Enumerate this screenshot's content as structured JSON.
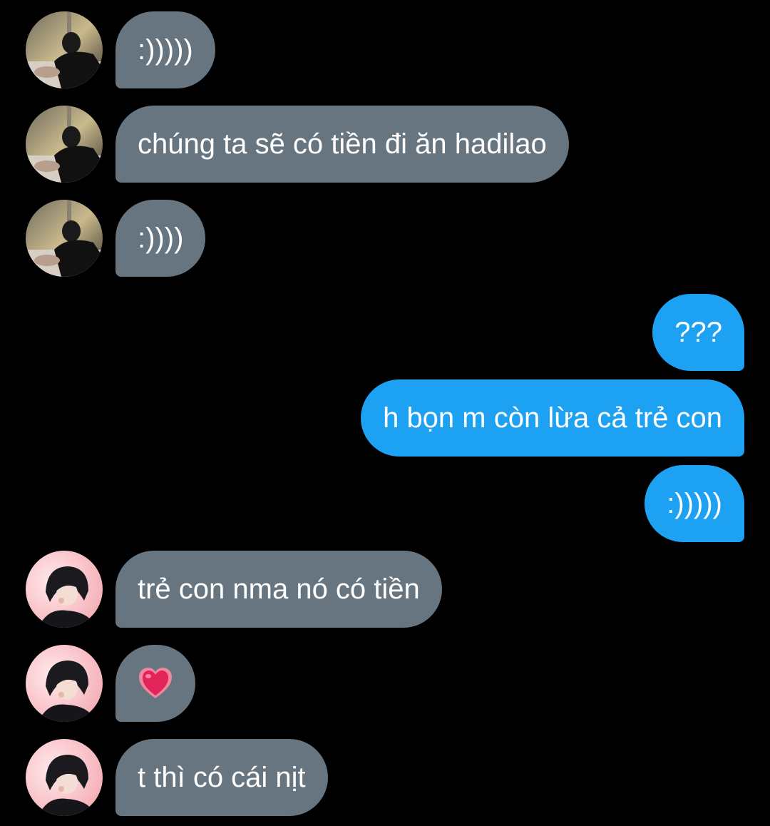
{
  "colors": {
    "background": "#000000",
    "incoming_bubble": "#66757f",
    "outgoing_bubble": "#1da1f2",
    "text": "#ffffff"
  },
  "messages": [
    {
      "sender": "other-1",
      "direction": "incoming",
      "text": ":)))))"
    },
    {
      "sender": "other-1",
      "direction": "incoming",
      "text": "chúng ta sẽ có tiền đi ăn hadilao"
    },
    {
      "sender": "other-1",
      "direction": "incoming",
      "text": ":))))"
    },
    {
      "sender": "me",
      "direction": "outgoing",
      "text": "???"
    },
    {
      "sender": "me",
      "direction": "outgoing",
      "text": "h bọn m còn lừa cả trẻ con"
    },
    {
      "sender": "me",
      "direction": "outgoing",
      "text": ":)))))"
    },
    {
      "sender": "other-2",
      "direction": "incoming",
      "text": "trẻ con nma nó có tiền"
    },
    {
      "sender": "other-2",
      "direction": "incoming",
      "emoji": "beating-heart-icon"
    },
    {
      "sender": "other-2",
      "direction": "incoming",
      "text": "t thì có cái nịt"
    }
  ]
}
